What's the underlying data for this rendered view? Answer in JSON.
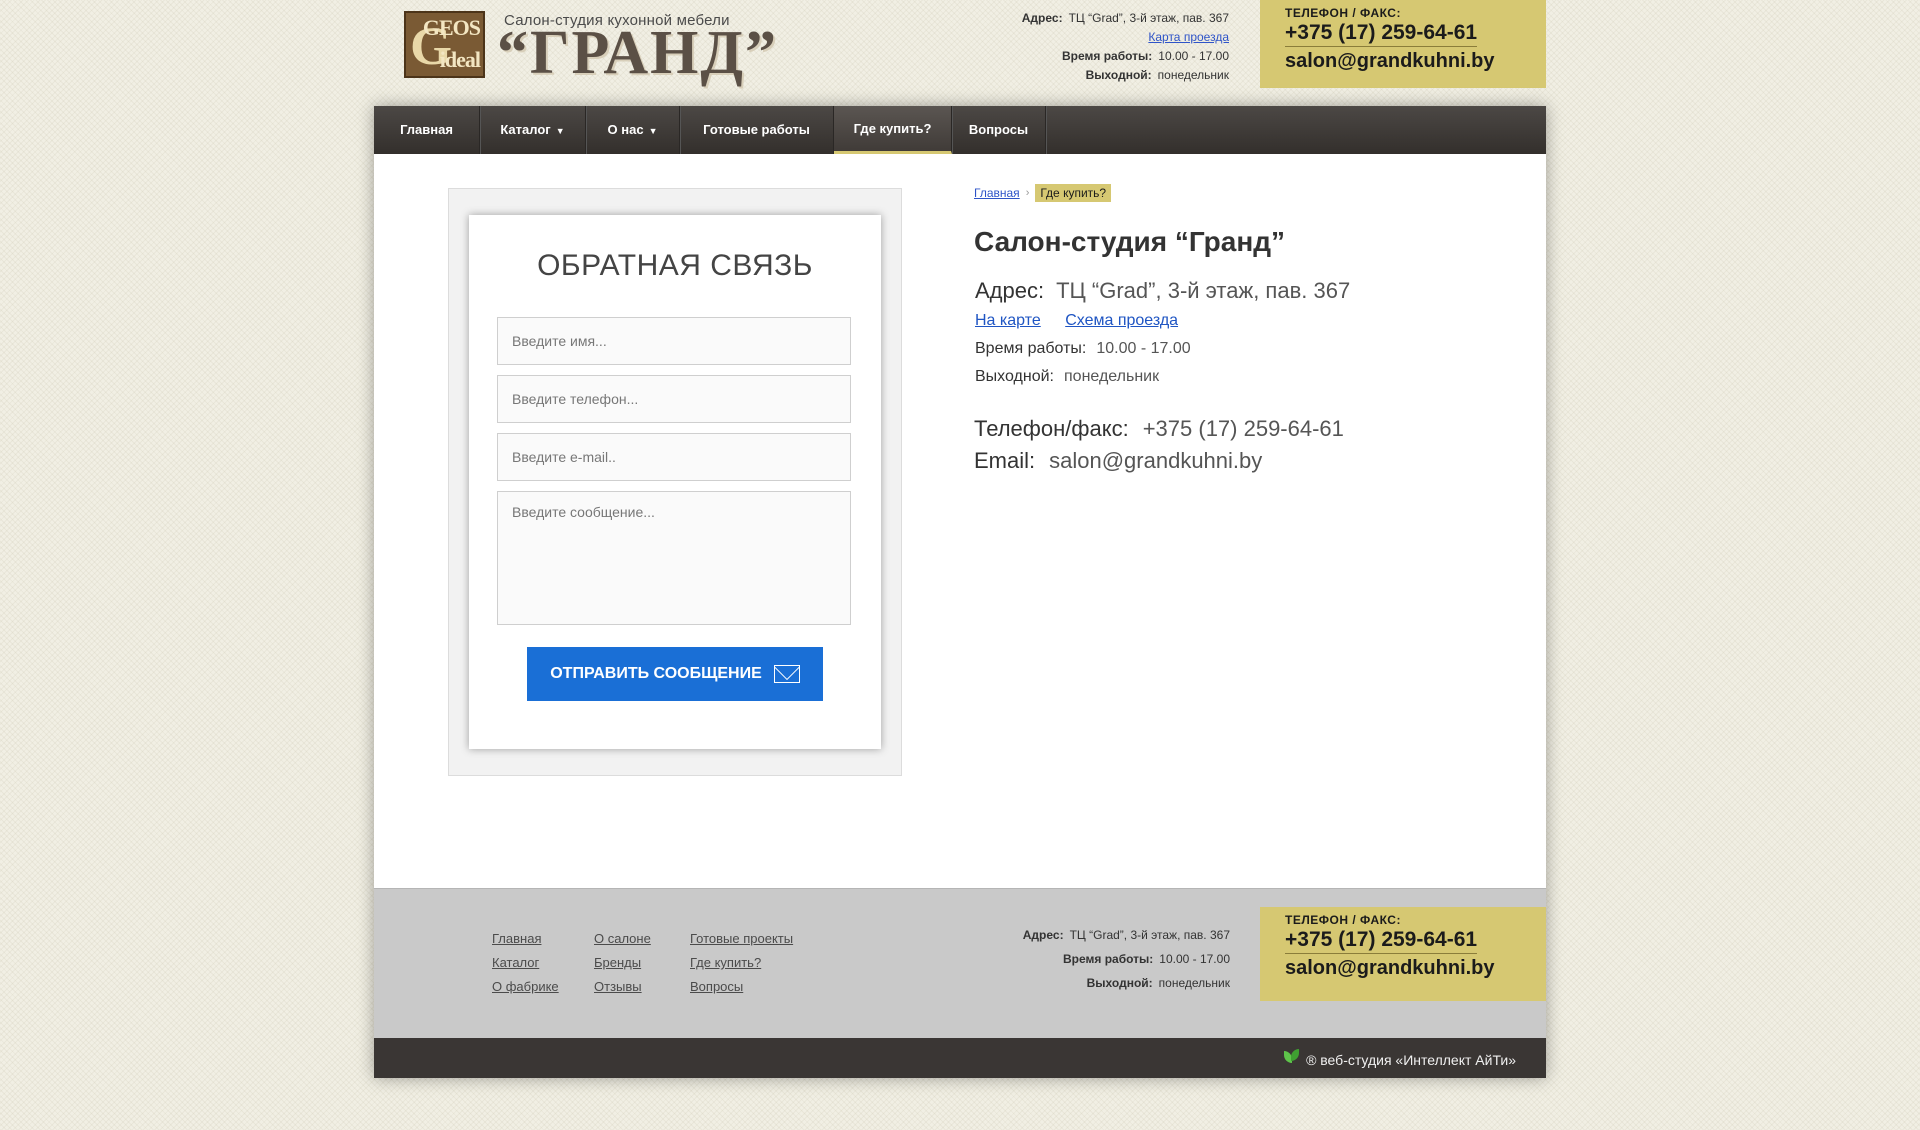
{
  "logo": {
    "g": "G",
    "geos": "GEOS",
    "ideal": "ideal"
  },
  "header": {
    "tagline": "Салон-студия кухонной мебели",
    "brand": "“ГРАНД”",
    "address_label": "Адрес:",
    "address": "ТЦ “Grad”, 3-й этаж, пав. 367",
    "map_link": "Карта проезда",
    "hours_label": "Время работы:",
    "hours": "10.00 - 17.00",
    "dayoff_label": "Выходной:",
    "dayoff": "понедельник",
    "phone_label": "ТЕЛЕФОН  /  ФАКС:",
    "phone": "+375 (17) 259-64-61",
    "email": "salon@grandkuhni.by"
  },
  "nav": [
    {
      "label": "Главная"
    },
    {
      "label": "Каталог",
      "arrow": "▼"
    },
    {
      "label": "О нас",
      "arrow": "▼"
    },
    {
      "label": "Готовые работы"
    },
    {
      "label": "Где купить?",
      "active": true
    },
    {
      "label": "Вопросы"
    }
  ],
  "form": {
    "title": "ОБРАТНАЯ СВЯЗЬ",
    "name_placeholder": "Введите имя...",
    "phone_placeholder": "Введите телефон...",
    "email_placeholder": "Введите e-mail..",
    "message_placeholder": "Введите сообщение...",
    "submit_label": "ОТПРАВИТЬ СООБЩЕНИЕ"
  },
  "breadcrumb": {
    "home": "Главная",
    "separator": "›",
    "current": "Где купить?"
  },
  "info": {
    "title": "Салон-студия “Гранд”",
    "address_label": "Адрес:",
    "address": "ТЦ “Grad”, 3-й этаж, пав. 367",
    "map_link": "На карте",
    "scheme_link": "Схема проезда",
    "hours_label": "Время работы:",
    "hours": "10.00 - 17.00",
    "dayoff_label": "Выходной:",
    "dayoff": "понедельник",
    "phone_label": "Телефон/факс:",
    "phone": "+375 (17) 259-64-61",
    "email_label": "Email:",
    "email": "salon@grandkuhni.by"
  },
  "footer": {
    "col1": [
      "Главная",
      "Каталог",
      "О фабрике"
    ],
    "col2": [
      "О салоне",
      "Бренды",
      "Отзывы"
    ],
    "col3": [
      "Готовые проекты",
      "Где купить?",
      "Вопросы"
    ],
    "address_label": "Адрес:",
    "address": "ТЦ “Grad”, 3-й этаж, пав. 367",
    "hours_label": "Время работы:",
    "hours": "10.00 - 17.00",
    "dayoff_label": "Выходной:",
    "dayoff": "понедельник",
    "phone_label": "ТЕЛЕФОН  /  ФАКС:",
    "phone": "+375 (17) 259-64-61",
    "email": "salon@grandkuhni.by",
    "studio": "® веб-студия «Интеллект АйТи»"
  },
  "colors": {
    "accent": "#d6c872",
    "nav_bg": "#3a3634",
    "button": "#1a6fd6",
    "link": "#2f54c8"
  }
}
